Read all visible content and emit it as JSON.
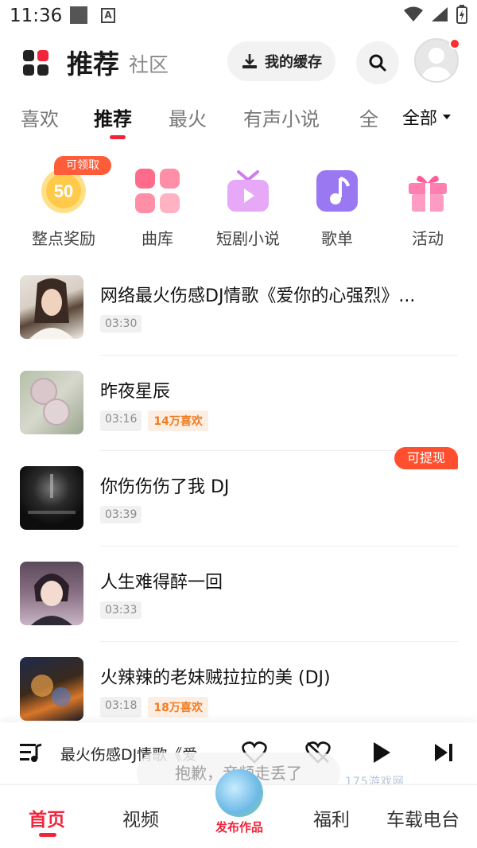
{
  "status_bar": {
    "time": "11:36"
  },
  "header": {
    "title": "推荐",
    "subtitle": "社区",
    "cache_label": "我的缓存"
  },
  "tabs": [
    {
      "label": "喜欢"
    },
    {
      "label": "推荐"
    },
    {
      "label": "最火"
    },
    {
      "label": "有声小说"
    },
    {
      "label": "全"
    }
  ],
  "tab_all_label": "全部",
  "features": [
    {
      "label": "整点奖励",
      "icon": "coin-50-icon",
      "coin_text": "50",
      "badge": "可领取"
    },
    {
      "label": "曲库",
      "icon": "library-grid-icon"
    },
    {
      "label": "短剧小说",
      "icon": "tv-play-icon"
    },
    {
      "label": "歌单",
      "icon": "music-note-icon"
    },
    {
      "label": "活动",
      "icon": "gift-icon"
    }
  ],
  "songs": [
    {
      "title": "网络最火伤感DJ情歌《爱你的心强烈》...",
      "duration": "03:30",
      "likes": ""
    },
    {
      "title": "昨夜星辰",
      "duration": "03:16",
      "likes": "14万喜欢"
    },
    {
      "title": "你伤伤伤了我 DJ",
      "duration": "03:39",
      "likes": ""
    },
    {
      "title": "人生难得醉一回",
      "duration": "03:33",
      "likes": ""
    },
    {
      "title": "火辣辣的老妹贼拉拉的美 (DJ)",
      "duration": "03:18",
      "likes": "18万喜欢"
    }
  ],
  "withdraw_badge": "可提现",
  "player": {
    "now_playing": "最火伤感DJ情歌《爱"
  },
  "toast": "抱歉，音频走丢了",
  "watermark": "175游戏网",
  "bottom_nav": {
    "home": "首页",
    "video": "视频",
    "publish": "发布作品",
    "welfare": "福利",
    "car_radio": "车载电台"
  },
  "colors": {
    "accent": "#f2243c",
    "orange": "#f07c22",
    "badge": "#ff5d3a"
  }
}
